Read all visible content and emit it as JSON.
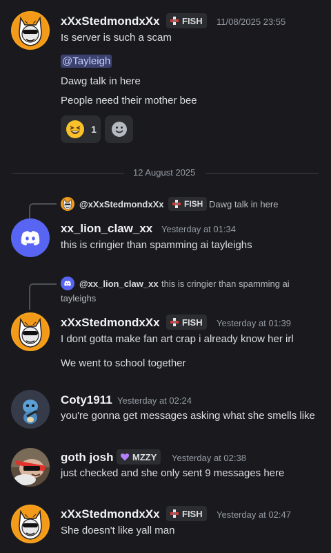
{
  "messages": [
    {
      "author": "xXxStedmondxXx",
      "tag": "FISH",
      "timestamp": "11/08/2025 23:55",
      "lines": [
        "Is server is such a scam",
        "@Tayleigh",
        "Dawg talk in here",
        "People need their mother bee"
      ],
      "reactions": [
        {
          "icon": "laughing-emoji",
          "count": "1"
        },
        {
          "icon": "add-reaction-smiley"
        }
      ]
    }
  ],
  "date_divider": "12 August 2025",
  "reply1": {
    "author": "@xXxStedmondxXx",
    "tag": "FISH",
    "text": "Dawg talk in here"
  },
  "msg2": {
    "author": "xx_lion_claw_xx",
    "timestamp": "Yesterday at 01:34",
    "text": "this is cringier than spamming ai tayleighs"
  },
  "reply2": {
    "author": "@xx_lion_claw_xx",
    "text_line1": "this is cringier than spamming ai",
    "text_line2": "tayleighs"
  },
  "msg3": {
    "author": "xXxStedmondxXx",
    "tag": "FISH",
    "timestamp": "Yesterday at 01:39",
    "line1": "I dont gotta make fan art crap i already know her irl",
    "line2": "We went to school together"
  },
  "msg4": {
    "author": "Coty1911",
    "timestamp": "Yesterday at 02:24",
    "text": "you're gonna get messages asking what she smells like"
  },
  "msg5": {
    "author": "goth josh",
    "tag": "MZZY",
    "timestamp": "Yesterday at 02:38",
    "text": "just checked and she only sent 9 messages here"
  },
  "msg6": {
    "author": "xXxStedmondxXx",
    "tag": "FISH",
    "timestamp": "Yesterday at 02:47",
    "text": "She doesn't like yall man"
  },
  "colors": {
    "background": "#1a1a1e",
    "mention_bg": "#3c4270",
    "discord_blurple": "#5865f2"
  }
}
